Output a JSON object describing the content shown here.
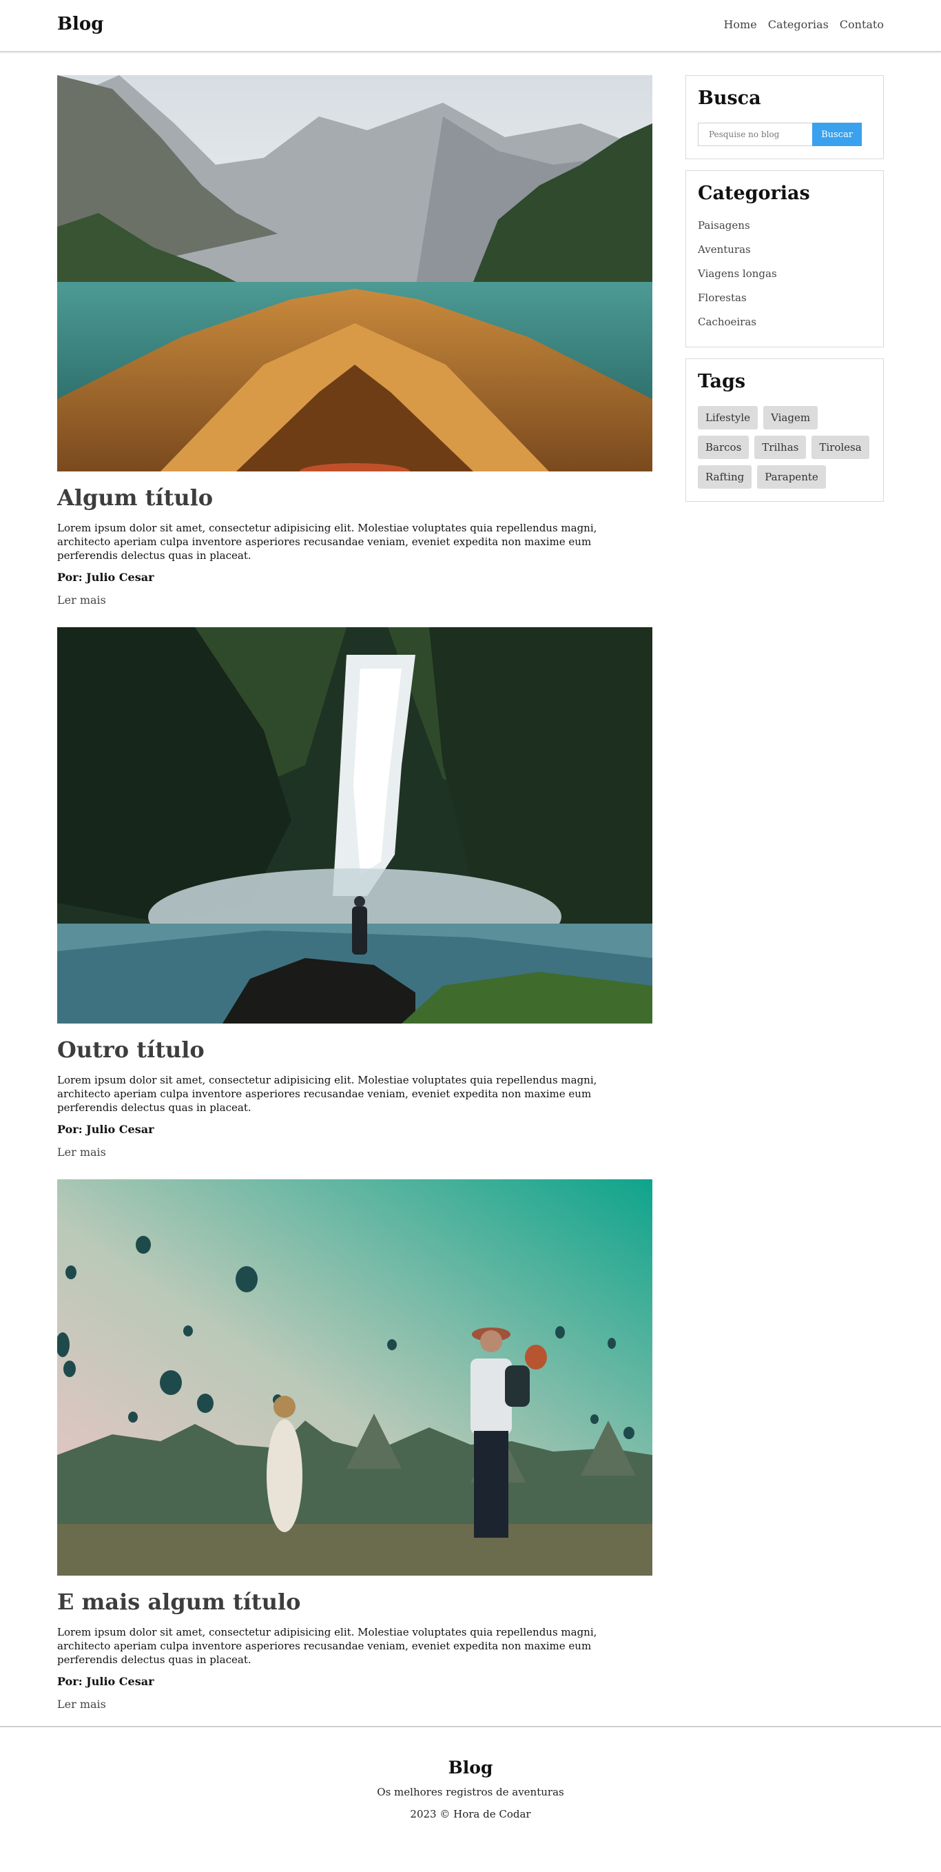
{
  "header": {
    "logo": "Blog",
    "nav": [
      "Home",
      "Categorias",
      "Contato"
    ]
  },
  "posts": [
    {
      "image_alt": "Barco de madeira em lago de montanha",
      "title": "Algum título",
      "excerpt": "Lorem ipsum dolor sit amet, consectetur adipisicing elit. Molestiae voluptates quia repellendus magni, architecto aperiam culpa inventore asperiores recusandae veniam, eveniet expedita non maxime eum perferendis delectus quas in placeat.",
      "author": "Por: Julio Cesar",
      "more": "Ler mais"
    },
    {
      "image_alt": "Pessoa diante de cachoeira",
      "title": "Outro título",
      "excerpt": "Lorem ipsum dolor sit amet, consectetur adipisicing elit. Molestiae voluptates quia repellendus magni, architecto aperiam culpa inventore asperiores recusandae veniam, eveniet expedita non maxime eum perferendis delectus quas in placeat.",
      "author": "Por: Julio Cesar",
      "more": "Ler mais"
    },
    {
      "image_alt": "Casal fotografando balões",
      "title": "E mais algum título",
      "excerpt": "Lorem ipsum dolor sit amet, consectetur adipisicing elit. Molestiae voluptates quia repellendus magni, architecto aperiam culpa inventore asperiores recusandae veniam, eveniet expedita non maxime eum perferendis delectus quas in placeat.",
      "author": "Por: Julio Cesar",
      "more": "Ler mais"
    }
  ],
  "sidebar": {
    "search": {
      "title": "Busca",
      "placeholder": "Pesquise no blog",
      "button": "Buscar"
    },
    "categories": {
      "title": "Categorias",
      "items": [
        "Paisagens",
        "Aventuras",
        "Viagens longas",
        "Florestas",
        "Cachoeiras"
      ]
    },
    "tags": {
      "title": "Tags",
      "items": [
        "Lifestyle",
        "Viagem",
        "Barcos",
        "Trilhas",
        "Tirolesa",
        "Rafting",
        "Parapente"
      ]
    }
  },
  "footer": {
    "title": "Blog",
    "tagline": "Os melhores registros de aventuras",
    "copyright": "2023 © Hora de Codar"
  },
  "colors": {
    "accent": "#3aa1ee",
    "tag_bg": "#dcdcdc"
  }
}
